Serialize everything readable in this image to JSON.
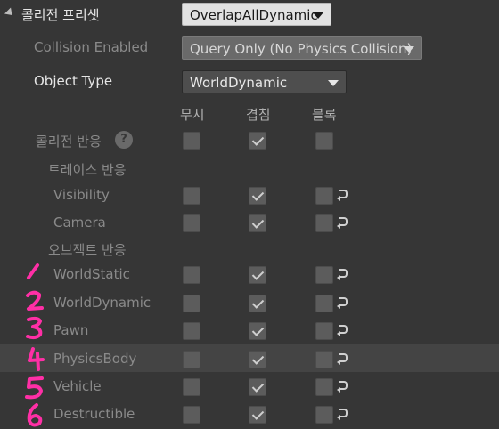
{
  "preset": {
    "label": "콜리전 프리셋",
    "value": "OverlapAllDynamic"
  },
  "collision_enabled": {
    "label": "Collision Enabled",
    "value": "Query Only (No Physics Collision)"
  },
  "object_type": {
    "label": "Object Type",
    "value": "WorldDynamic"
  },
  "columns": [
    "무시",
    "겹침",
    "블록"
  ],
  "collision_response": {
    "label": "콜리전 반응"
  },
  "trace_section": {
    "label": "트레이스 반응"
  },
  "trace_rows": [
    {
      "label": "Visibility",
      "value": "overlap"
    },
    {
      "label": "Camera",
      "value": "overlap"
    }
  ],
  "object_section": {
    "label": "오브젝트 반응"
  },
  "object_rows": [
    {
      "label": "WorldStatic",
      "value": "overlap",
      "annotation": "1"
    },
    {
      "label": "WorldDynamic",
      "value": "overlap",
      "annotation": "2"
    },
    {
      "label": "Pawn",
      "value": "overlap",
      "annotation": "3"
    },
    {
      "label": "PhysicsBody",
      "value": "overlap",
      "annotation": "4"
    },
    {
      "label": "Vehicle",
      "value": "overlap",
      "annotation": "5"
    },
    {
      "label": "Destructible",
      "value": "overlap",
      "annotation": "6"
    }
  ],
  "icons": {
    "expand": "collapse-triangle-icon",
    "help": "help-icon",
    "reset": "reset-to-default-icon"
  },
  "colors": {
    "background": "#363636",
    "highlight_row": "#444444",
    "annotation": "#ff2fa6"
  }
}
